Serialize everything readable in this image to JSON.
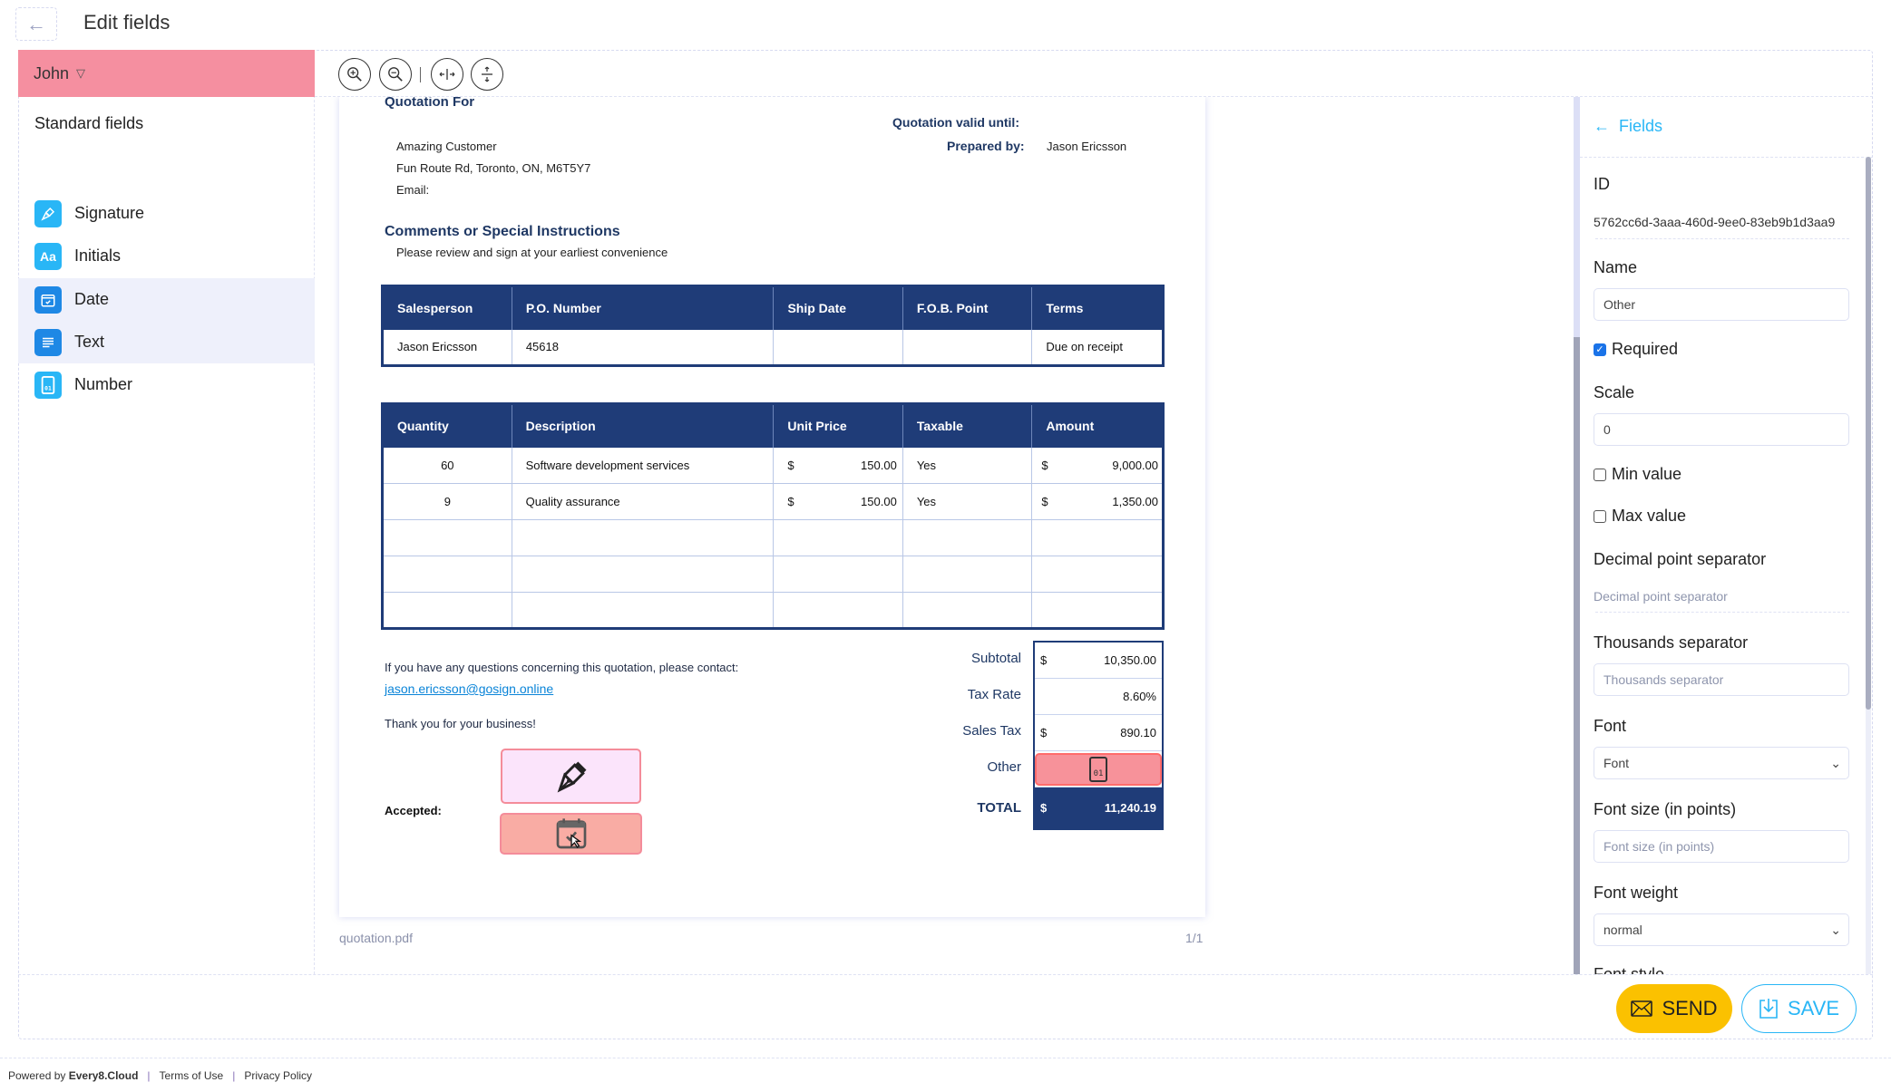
{
  "header": {
    "back_icon": "arrow-left-icon",
    "title": "Edit fields"
  },
  "sidebar": {
    "signer": "John",
    "signer_caret": "▽",
    "section_title": "Standard fields",
    "items": [
      {
        "label": "Signature",
        "icon": "pen-nib-icon",
        "glyph": "✎"
      },
      {
        "label": "Initials",
        "icon": "initials-icon",
        "glyph": "Aa"
      },
      {
        "label": "Date",
        "icon": "calendar-check-icon",
        "glyph": "☑"
      },
      {
        "label": "Text",
        "icon": "text-lines-icon",
        "glyph": "≡"
      },
      {
        "label": "Number",
        "icon": "number-icon",
        "glyph": "01"
      }
    ]
  },
  "toolbar": {
    "zoom_in": "zoom-in-icon",
    "zoom_out": "zoom-out-icon",
    "fit_width": "fit-width-icon",
    "fit_height": "fit-height-icon"
  },
  "document": {
    "quotation_for": "Quotation For",
    "valid_until_label": "Quotation valid until:",
    "prepared_by_label": "Prepared by:",
    "prepared_by": "Jason Ericsson",
    "customer_name": "Amazing Customer",
    "customer_address": "Fun Route Rd, Toronto, ON, M6T5Y7",
    "customer_email_label": "Email:",
    "comments_title": "Comments or Special Instructions",
    "comments_text": "Please review and sign at your earliest convenience",
    "info_table": {
      "headers": [
        "Salesperson",
        "P.O. Number",
        "Ship Date",
        "F.O.B. Point",
        "Terms"
      ],
      "row": [
        "Jason Ericsson",
        "45618",
        "",
        "",
        "Due on receipt"
      ]
    },
    "items_table": {
      "headers": [
        "Quantity",
        "Description",
        "Unit Price",
        "Taxable",
        "Amount"
      ],
      "rows": [
        {
          "qty": "60",
          "desc": "Software development services",
          "cur1": "$",
          "unit": "150.00",
          "taxable": "Yes",
          "cur2": "$",
          "amount": "9,000.00"
        },
        {
          "qty": "9",
          "desc": "Quality assurance",
          "cur1": "$",
          "unit": "150.00",
          "taxable": "Yes",
          "cur2": "$",
          "amount": "1,350.00"
        }
      ]
    },
    "contact_text": "If you have any questions concerning this quotation, please contact:",
    "contact_email": "jason.ericsson@gosign.online",
    "thanks": "Thank you for your business!",
    "accepted_label": "Accepted:",
    "totals": {
      "subtotal_label": "Subtotal",
      "subtotal_cur": "$",
      "subtotal": "10,350.00",
      "tax_rate_label": "Tax Rate",
      "tax_rate": "8.60%",
      "sales_tax_label": "Sales Tax",
      "sales_tax_cur": "$",
      "sales_tax": "890.10",
      "other_label": "Other",
      "other_field_glyph": "01",
      "total_label": "TOTAL",
      "total_cur": "$",
      "total": "11,240.19"
    },
    "file_name": "quotation.pdf",
    "page_indicator": "1/1"
  },
  "panel": {
    "back_label": "Fields",
    "id_label": "ID",
    "id_value": "5762cc6d-3aaa-460d-9ee0-83eb9b1d3aa9",
    "name_label": "Name",
    "name_value": "Other",
    "required_label": "Required",
    "required_checked": true,
    "scale_label": "Scale",
    "scale_value": "0",
    "min_label": "Min value",
    "max_label": "Max value",
    "decimal_label": "Decimal point separator",
    "decimal_placeholder": "Decimal point separator",
    "thousands_label": "Thousands separator",
    "thousands_placeholder": "Thousands separator",
    "font_label": "Font",
    "font_value": "Font",
    "font_size_label": "Font size (in points)",
    "font_size_placeholder": "Font size (in points)",
    "font_weight_label": "Font weight",
    "font_weight_value": "normal",
    "next_label_partial": "Font style"
  },
  "actions": {
    "send": "SEND",
    "save": "SAVE"
  },
  "footer": {
    "powered_by": "Powered by",
    "brand": "Every8.Cloud",
    "sep": "|",
    "terms": "Terms of Use",
    "privacy": "Privacy Policy"
  },
  "colors": {
    "signer_bg": "#f58fa0",
    "accent": "#29b6f6",
    "table_header": "#1f3c78",
    "send_button": "#fbc100",
    "field_highlight": "#f7929a"
  }
}
